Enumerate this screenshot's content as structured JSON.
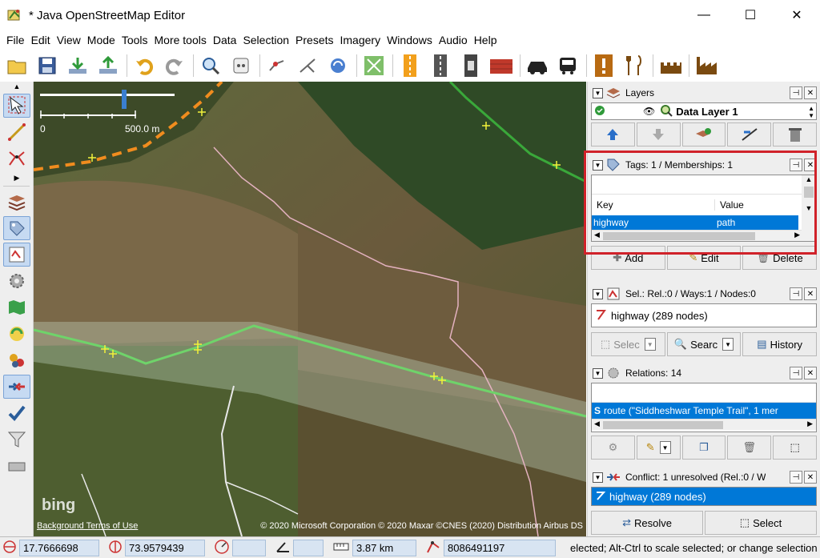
{
  "window": {
    "title": "* Java OpenStreetMap Editor",
    "minimize": "—",
    "maximize": "☐",
    "close": "✕"
  },
  "menu": [
    "File",
    "Edit",
    "View",
    "Mode",
    "Tools",
    "More tools",
    "Data",
    "Selection",
    "Presets",
    "Imagery",
    "Windows",
    "Audio",
    "Help"
  ],
  "toolbar": {
    "icons": [
      "open-file-icon",
      "save-icon",
      "download-icon",
      "upload-icon",
      "undo-icon",
      "redo-icon",
      "zoom-icon",
      "preferences-icon",
      "split-way-icon",
      "combine-way-icon",
      "reverse-way-icon",
      "align-icon",
      "road-marking-icon",
      "highway-icon",
      "traffic-light-icon",
      "building-icon",
      "car-icon",
      "bus-icon",
      "warning-icon",
      "restaurant-icon",
      "castle-icon",
      "factory-icon"
    ]
  },
  "left_tools": [
    "select-tool-icon",
    "draw-tool-icon",
    "improve-way-tool-icon",
    "layers-toggle-icon",
    "tags-toggle-icon",
    "selection-list-icon",
    "preferences-toggle-icon",
    "map-paint-icon",
    "history-toggle-icon",
    "relations-toggle-icon",
    "conflict-toggle-icon",
    "validation-icon",
    "filter-icon",
    "audio-icon"
  ],
  "map": {
    "scale_min": "0",
    "scale_max": "500.0 m",
    "bing": "bing",
    "attribution_left": "Background Terms of Use",
    "attribution_right": "© 2020 Microsoft Corporation © 2020 Maxar ©CNES (2020) Distribution Airbus DS"
  },
  "layers": {
    "title": "Layers",
    "layer_name": "Data Layer 1"
  },
  "tags": {
    "title": "Tags: 1 / Memberships: 1",
    "col_key": "Key",
    "col_value": "Value",
    "row_key": "highway",
    "row_value": "path",
    "add": "Add",
    "edit": "Edit",
    "delete": "Delete"
  },
  "selection": {
    "title": "Sel.: Rel.:0 / Ways:1 / Nodes:0",
    "item": "highway (289 nodes)",
    "select": "Selec",
    "search": "Searc",
    "history": "History"
  },
  "relations": {
    "title": "Relations: 14",
    "item": "route (\"Siddheshwar Temple Trail\", 1 mer"
  },
  "conflict": {
    "title": "Conflict: 1 unresolved (Rel.:0 / W",
    "item": "highway (289 nodes)",
    "resolve": "Resolve",
    "select": "Select"
  },
  "status": {
    "lat": "17.7666698",
    "lon": "73.9579439",
    "distance": "3.87 km",
    "id": "8086491197",
    "message": "elected; Alt-Ctrl to scale selected; or change selection"
  },
  "colors": {
    "accent": "#0078d7",
    "highlight": "#d0222a",
    "track_orange": "#f08c1e",
    "path_green": "#6fd36a"
  }
}
